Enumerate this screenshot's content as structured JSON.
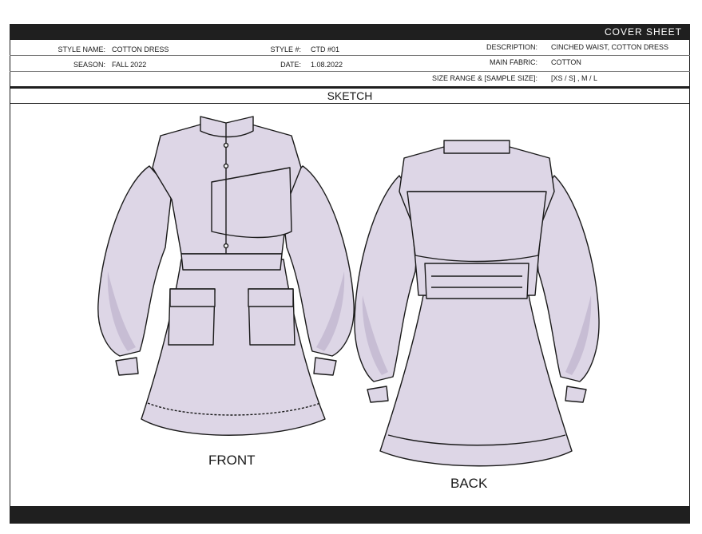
{
  "header": {
    "title": "COVER SHEET"
  },
  "meta": {
    "style_name_label": "STYLE NAME:",
    "style_name": "COTTON DRESS",
    "season_label": "SEASON:",
    "season": "FALL 2022",
    "style_no_label": "STYLE #:",
    "style_no": "CTD #01",
    "date_label": "DATE:",
    "date": "1.08.2022",
    "description_label": "DESCRIPTION:",
    "description": "CINCHED WAIST, COTTON DRESS",
    "fabric_label": "MAIN FABRIC:",
    "fabric": "COTTON",
    "size_label": "SIZE RANGE & [SAMPLE SIZE]:",
    "size": "[XS / S] , M / L"
  },
  "sketch": {
    "title": "SKETCH",
    "front_label": "FRONT",
    "back_label": "BACK"
  },
  "colors": {
    "garment_fill": "#ddd6e6",
    "garment_shade": "#c7bdd4",
    "bar": "#1f1f1f"
  }
}
